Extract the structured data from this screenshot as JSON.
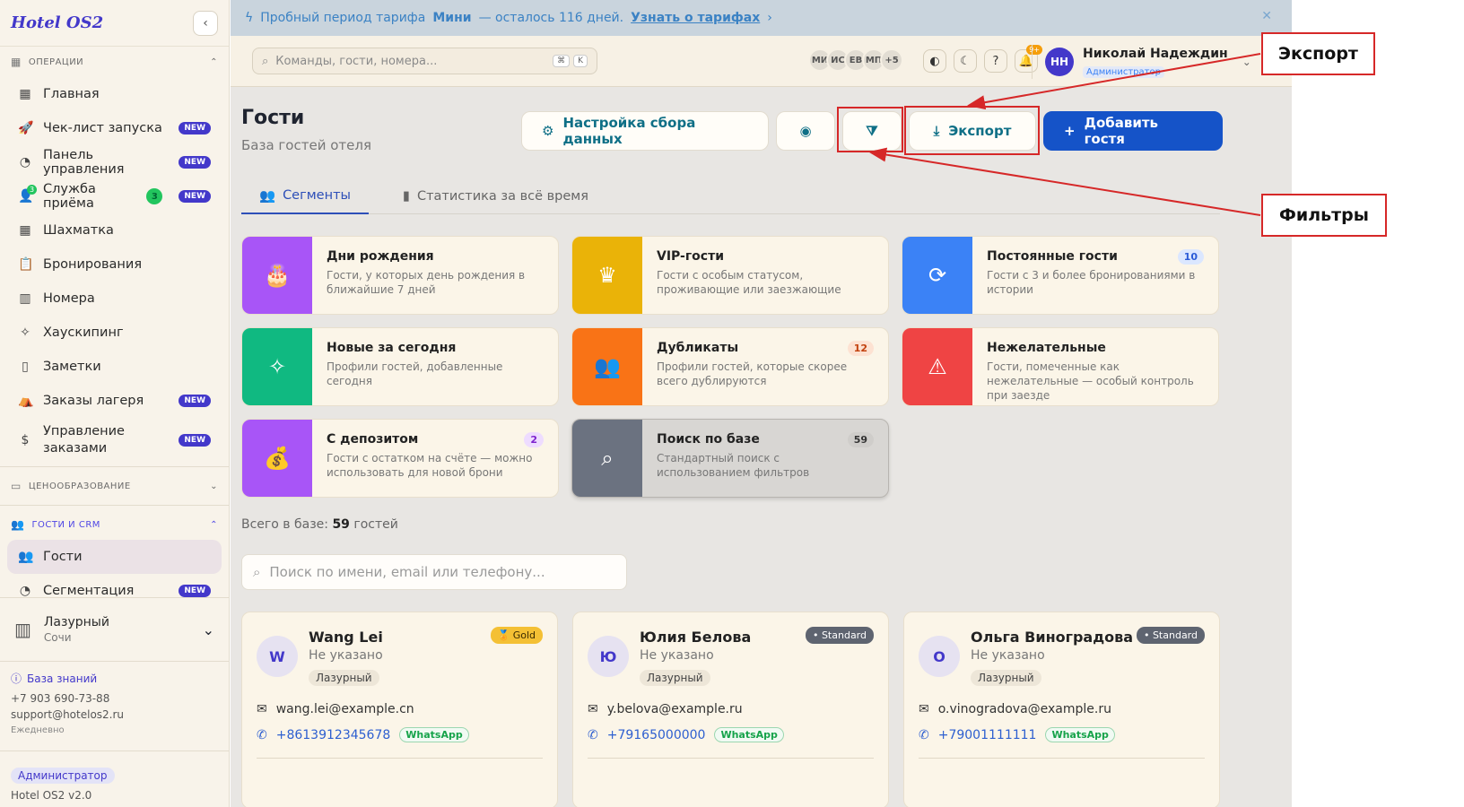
{
  "sidebar": {
    "logo": "Hotel OS2",
    "collapse_glyph": "‹",
    "sections": {
      "ops": "ОПЕРАЦИИ",
      "pricing": "ЦЕНООБРАЗОВАНИЕ",
      "crm": "ГОСТИ И CRM"
    },
    "items": [
      {
        "label": "Главная",
        "icon": "grid-icon"
      },
      {
        "label": "Чек-лист запуска",
        "icon": "rocket-icon",
        "badge": "NEW"
      },
      {
        "label": "Панель управления",
        "icon": "gauge-icon",
        "badge": "NEW"
      },
      {
        "label": "Служба приёма",
        "icon": "users-icon",
        "count": "3",
        "badge": "NEW"
      },
      {
        "label": "Шахматка",
        "icon": "table-icon"
      },
      {
        "label": "Бронирования",
        "icon": "clipboard-icon"
      },
      {
        "label": "Номера",
        "icon": "building-icon"
      },
      {
        "label": "Хаускипинг",
        "icon": "sparkles-icon"
      },
      {
        "label": "Заметки",
        "icon": "note-icon"
      },
      {
        "label": "Заказы лагеря",
        "icon": "tent-icon",
        "badge": "NEW"
      },
      {
        "label": "Управление заказами",
        "icon": "receipt-icon",
        "badge": "NEW"
      },
      {
        "label": "Гости",
        "icon": "users-icon"
      },
      {
        "label": "Сегментация",
        "icon": "pie-icon",
        "badge": "NEW"
      }
    ],
    "hotel": {
      "name": "Лазурный",
      "city": "Сочи"
    },
    "support": {
      "kb": "База знаний",
      "phone": "+7 903 690-73-88",
      "email": "support@hotelos2.ru",
      "hours": "Ежедневно"
    },
    "role": "Администратор",
    "version": "Hotel OS2 v2.0"
  },
  "trial": {
    "prefix": "Пробный период тарифа",
    "plan": "Мини",
    "suffix": "— осталось 116 дней.",
    "link": "Узнать о тарифах"
  },
  "topbar": {
    "search_placeholder": "Команды, гости, номера...",
    "kbd1": "⌘",
    "kbd2": "K",
    "avatars": [
      "МИ",
      "ИС",
      "ЕВ",
      "МП",
      "+5"
    ],
    "notif_badge": "9+",
    "user_initials": "НН",
    "user_name": "Николай Надеждин",
    "user_role": "Администратор"
  },
  "page": {
    "title": "Гости",
    "subtitle": "База гостей отеля",
    "btn_settings": "Настройка сбора данных",
    "btn_export": "Экспорт",
    "btn_add": "Добавить гостя",
    "tabs": [
      "Сегменты",
      "Статистика за всё время"
    ]
  },
  "segments": [
    {
      "title": "Дни рождения",
      "desc": "Гости, у которых день рождения в ближайшие 7 дней",
      "color": "#a855f7",
      "icon": "cake-icon",
      "glyph": "🎂"
    },
    {
      "title": "VIP-гости",
      "desc": "Гости с особым статусом, проживающие или заезжающие",
      "color": "#eab308",
      "icon": "crown-icon",
      "glyph": "♛"
    },
    {
      "title": "Постоянные гости",
      "desc": "Гости с 3 и более бронированиями в истории",
      "count": "10",
      "color": "#3b82f6",
      "icon": "refresh-icon",
      "glyph": "⟳"
    },
    {
      "title": "Новые за сегодня",
      "desc": "Профили гостей, добавленные сегодня",
      "color": "#10b981",
      "icon": "sparkles-icon",
      "glyph": "✧"
    },
    {
      "title": "Дубликаты",
      "desc": "Профили гостей, которые скорее всего дублируются",
      "count": "12",
      "color": "#f97316",
      "icon": "users-icon",
      "glyph": "👥"
    },
    {
      "title": "Нежелательные",
      "desc": "Гости, помеченные как нежелательные — особый контроль при заезде",
      "color": "#ef4444",
      "icon": "warning-icon",
      "glyph": "⚠"
    },
    {
      "title": "С депозитом",
      "desc": "Гости с остатком на счёте — можно использовать для новой брони",
      "count": "2",
      "color": "#a855f7",
      "icon": "money-bag-icon",
      "glyph": "💰"
    },
    {
      "title": "Поиск по базе",
      "desc": "Стандартный поиск с использованием фильтров",
      "count": "59",
      "color": "#6b7280",
      "icon": "search-icon",
      "glyph": "⌕"
    }
  ],
  "total": {
    "prefix": "Всего в базе:",
    "count": "59",
    "suffix": "гостей"
  },
  "guest_search_placeholder": "Поиск по имени, email или телефону...",
  "guests": [
    {
      "initial": "W",
      "name": "Wang Lei",
      "sub": "Не указано",
      "hotel": "Лазурный",
      "tier": "Gold",
      "email": "wang.lei@example.cn",
      "phone": "+8613912345678",
      "wa": "WhatsApp"
    },
    {
      "initial": "Ю",
      "name": "Юлия Белова",
      "sub": "Не указано",
      "hotel": "Лазурный",
      "tier": "Standard",
      "email": "y.belova@example.ru",
      "phone": "+79165000000",
      "wa": "WhatsApp"
    },
    {
      "initial": "О",
      "name": "Ольга Виноградова",
      "sub": "Не указано",
      "hotel": "Лазурный",
      "tier": "Standard",
      "email": "o.vinogradova@example.ru",
      "phone": "+79001111111",
      "wa": "WhatsApp"
    }
  ],
  "annotations": {
    "export": "Экспорт",
    "filters": "Фильтры"
  },
  "colors": {
    "accent": "#4338ca",
    "primary_button": "#1553c8",
    "annotation": "#d62828"
  }
}
